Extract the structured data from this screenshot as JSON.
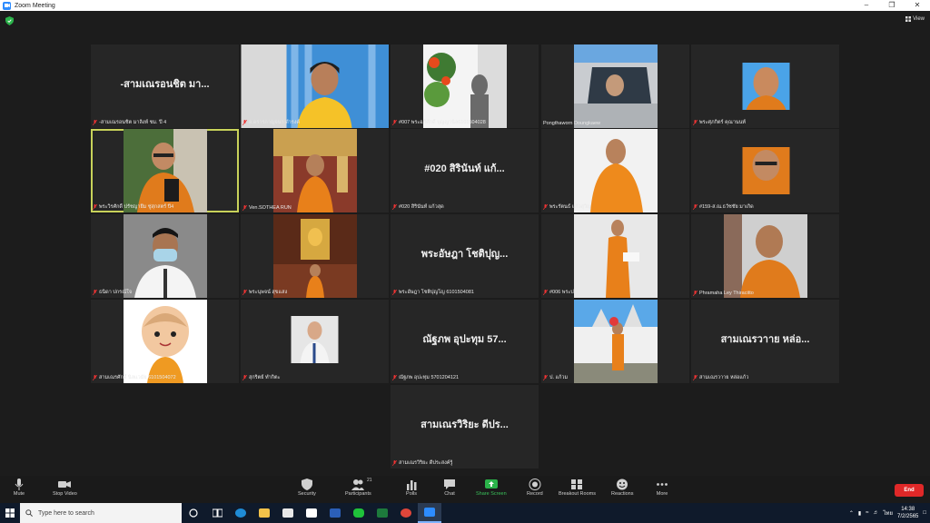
{
  "window": {
    "title": "Zoom Meeting"
  },
  "view_label": "View",
  "tiles": [
    {
      "label": "-สามเณรอนชิต มาลิงห์ ชม. ปี 4",
      "big": "-สามเณรอนชิต มา...",
      "kind": "text"
    },
    {
      "label": "อ.ดรารกาญจนา ดำรงค์",
      "kind": "photo-woman"
    },
    {
      "label": "#007 พระอภิศักดิ์ บุญญานิล6101504028",
      "kind": "photo-statue"
    },
    {
      "label": "Pongthaworn Doungkaew",
      "kind": "photo-car"
    },
    {
      "label": "พระศุภกิตร์ คุณานนท์",
      "kind": "photo-monk-small"
    },
    {
      "label": "พระวิรศักดิ์ ปรัชญายึม ซู่สุกสตร์ ปี4",
      "kind": "photo-man-shirt",
      "active": true
    },
    {
      "label": "Ven.SOTHEA RUN",
      "kind": "photo-temple-monk"
    },
    {
      "label": "#020 สิรินันท์ แก้วสุด",
      "big": "#020 สิรินันท์ แก้...",
      "kind": "text"
    },
    {
      "label": "พระรัตนธ์ แก้วสุวิญ",
      "kind": "photo-monk-robe"
    },
    {
      "label": "#159-ส.ณ.ธวัชชัย มาเกิด",
      "kind": "photo-monk-glasses"
    },
    {
      "label": "ธนิดา ปกรณ์ใจ",
      "kind": "photo-mask"
    },
    {
      "label": "พระนุพจน์ สุขแสง",
      "kind": "photo-shrine"
    },
    {
      "label": "พระอัษฎา โชติปุญโญ 6101504081",
      "big": "พระอัษฎา โชติปุญ...",
      "kind": "text"
    },
    {
      "label": "#006 พระปวรท อดีตเสน",
      "kind": "photo-monk-book"
    },
    {
      "label": "Phramaha Ley Thiracitto",
      "kind": "photo-monk-smile"
    },
    {
      "label": "สามเณรศักดิ์ นิลแวมัย 6101504072",
      "kind": "photo-cartoon"
    },
    {
      "label": "สุกริตย์ ทำกิตะ",
      "kind": "photo-small-man"
    },
    {
      "label": "ณัฐภพ อุปะทุม 5701204121",
      "big": "ณัฐภพ อุปะทุม 57...",
      "kind": "text"
    },
    {
      "label": "ป. แก้วม",
      "kind": "photo-temple-outdoor"
    },
    {
      "label": "สามเณรวาาย หล่อแก้ว",
      "big": "สามเณรวาาย หล่อ...",
      "kind": "text"
    },
    {
      "label": "สามเณรวิริยะ ดีประสงค์รู้",
      "big": "สามเณรวิริยะ ดีปร...",
      "kind": "text"
    }
  ],
  "toolbar": {
    "mute": "Mute",
    "stop_video": "Stop Video",
    "security": "Security",
    "participants": "Participants",
    "participants_count": "21",
    "polls": "Polls",
    "chat": "Chat",
    "share_screen": "Share Screen",
    "record": "Record",
    "breakout_rooms": "Breakout Rooms",
    "reactions": "Reactions",
    "more": "More",
    "end": "End"
  },
  "taskbar": {
    "search_placeholder": "Type here to search",
    "lang": "ไทย",
    "time": "14:38",
    "date": "7/2/2565"
  }
}
